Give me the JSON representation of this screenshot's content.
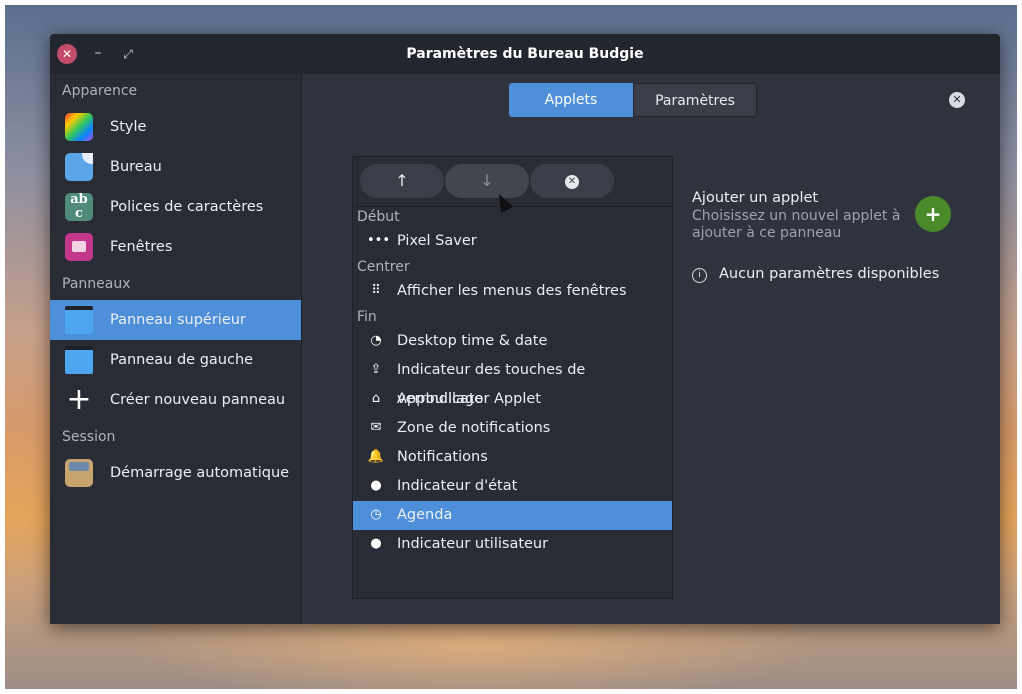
{
  "window": {
    "title": "Paramètres du Bureau Budgie"
  },
  "titlebar": {
    "close_glyph": "✕",
    "minimize_glyph": "–",
    "maximize_glyph": "⤢"
  },
  "sidebar": {
    "sections": [
      {
        "header": "Apparence",
        "items": [
          {
            "label": "Style",
            "icon": "style-icon"
          },
          {
            "label": "Bureau",
            "icon": "desktop-icon"
          },
          {
            "label": "Polices de caractères",
            "icon": "fonts-icon"
          },
          {
            "label": "Fenêtres",
            "icon": "windows-icon"
          }
        ]
      },
      {
        "header": "Panneaux",
        "items": [
          {
            "label": "Panneau supérieur",
            "icon": "panel-icon",
            "selected": true
          },
          {
            "label": "Panneau de gauche",
            "icon": "panel-icon"
          },
          {
            "label": "Créer nouveau panneau",
            "icon": "plus-icon"
          }
        ]
      },
      {
        "header": "Session",
        "items": [
          {
            "label": "Démarrage automatique",
            "icon": "autostart-icon"
          }
        ]
      }
    ]
  },
  "tabs": [
    {
      "label": "Applets",
      "active": true
    },
    {
      "label": "Paramètres",
      "active": false
    }
  ],
  "toolbar": {
    "up": "↑",
    "down": "↓",
    "remove": "✕"
  },
  "applets": {
    "groups": [
      {
        "header": "Début",
        "items": [
          {
            "label": "Pixel Saver",
            "icon": "dots-icon",
            "glyph": "•••"
          }
        ]
      },
      {
        "header": "Centrer",
        "items": [
          {
            "label": "Afficher les menus des fenêtres",
            "icon": "grid-dots-icon",
            "glyph": "⠿"
          }
        ]
      },
      {
        "header": "Fin",
        "items": [
          {
            "label": "Desktop time & date",
            "icon": "pie-clock-icon",
            "glyph": "◔"
          },
          {
            "label": "Indicateur des touches de verrouillage",
            "icon": "lock-keys-icon",
            "glyph": "⇪"
          },
          {
            "label": "AppIndicator Applet",
            "icon": "home-icon",
            "glyph": "⌂"
          },
          {
            "label": "Zone de notifications",
            "icon": "envelope-icon",
            "glyph": "✉"
          },
          {
            "label": "Notifications",
            "icon": "bell-icon",
            "glyph": "🔔"
          },
          {
            "label": "Indicateur d'état",
            "icon": "user-icon",
            "glyph": "●"
          },
          {
            "label": "Agenda",
            "icon": "clock-icon",
            "glyph": "◷",
            "selected": true
          },
          {
            "label": "Indicateur utilisateur",
            "icon": "user-icon",
            "glyph": "●"
          }
        ]
      }
    ]
  },
  "add_applet": {
    "title": "Ajouter un applet",
    "description": "Choisissez un nouvel applet à ajouter à ce panneau",
    "button_glyph": "+"
  },
  "settings_info": {
    "glyph": "i",
    "text": "Aucun paramètres disponibles"
  },
  "colors": {
    "accent": "#4d8fd8",
    "add_button": "#4a8a2a",
    "close_button": "#c54d6c"
  }
}
